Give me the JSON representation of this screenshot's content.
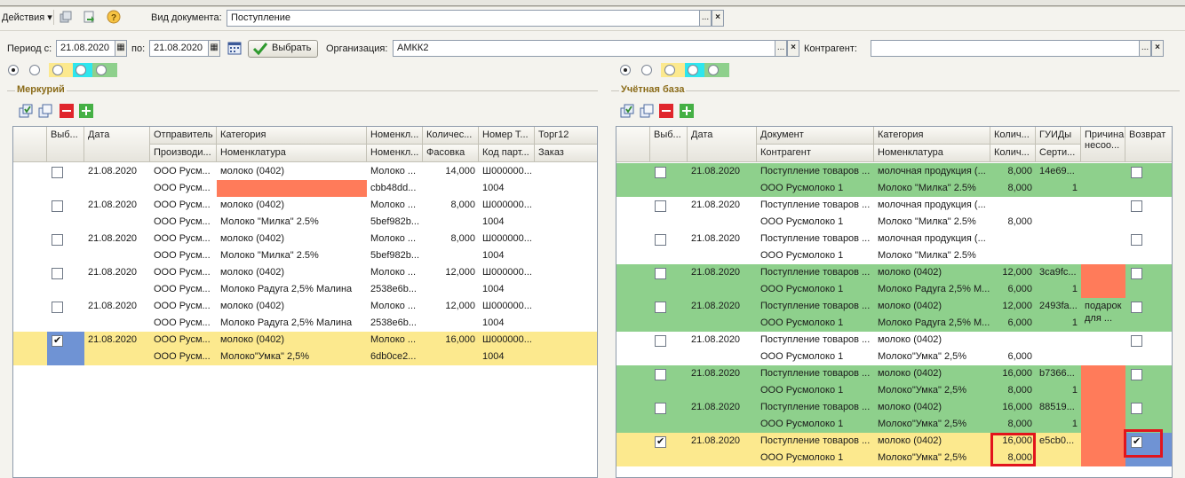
{
  "toolbar": {
    "actions_label": "Действия",
    "doc_type_label": "Вид документа:",
    "doc_type_value": "Поступление"
  },
  "filters": {
    "period_from_label": "Период с:",
    "period_from_value": "21.08.2020",
    "period_to_label": "по:",
    "period_to_value": "21.08.2020",
    "select_button": "Выбрать",
    "org_label": "Организация:",
    "org_value": "АМКК2",
    "counterparty_label": "Контрагент:",
    "counterparty_value": ""
  },
  "colors": {
    "green": "#8ed08c",
    "yellow": "#fce98e",
    "salmon": "#ff7b5a",
    "cyan": "#2ee6ee",
    "select_blue": "#6f93d4"
  },
  "left": {
    "title": "Меркурий",
    "headers_top": [
      "Выб...",
      "Дата",
      "Отправитель",
      "Категория",
      "Номенкл...",
      "Количес...",
      "Номер Т...",
      "Торг12"
    ],
    "headers_bottom": [
      "",
      "",
      "Производи...",
      "Номенклатура",
      "Номенкл...",
      "Фасовка",
      "Код парт...",
      "Заказ"
    ],
    "rows": [
      {
        "checked": false,
        "date": "21.08.2020",
        "sender": "ООО Русм...",
        "category": "молоко (0402)",
        "nom1": "Молоко ...",
        "qty": "14,000",
        "num": "Ш000000...",
        "torg": "",
        "producer": "ООО Русм...",
        "nomenclature": "",
        "nom2": "cbb48dd...",
        "pack": "",
        "code": "1004",
        "order": "",
        "highlight": "none",
        "salmon_nom": true
      },
      {
        "checked": false,
        "date": "21.08.2020",
        "sender": "ООО Русм...",
        "category": "молоко (0402)",
        "nom1": "Молоко ...",
        "qty": "8,000",
        "num": "Ш000000...",
        "torg": "",
        "producer": "ООО Русм...",
        "nomenclature": "Молоко \"Милка\" 2.5%",
        "nom2": "5bef982b...",
        "pack": "",
        "code": "1004",
        "order": "",
        "highlight": "none",
        "salmon_nom": false
      },
      {
        "checked": false,
        "date": "21.08.2020",
        "sender": "ООО Русм...",
        "category": "молоко (0402)",
        "nom1": "Молоко ...",
        "qty": "8,000",
        "num": "Ш000000...",
        "torg": "",
        "producer": "ООО Русм...",
        "nomenclature": "Молоко \"Милка\" 2.5%",
        "nom2": "5bef982b...",
        "pack": "",
        "code": "1004",
        "order": "",
        "highlight": "none",
        "salmon_nom": false
      },
      {
        "checked": false,
        "date": "21.08.2020",
        "sender": "ООО Русм...",
        "category": "молоко (0402)",
        "nom1": "Молоко ...",
        "qty": "12,000",
        "num": "Ш000000...",
        "torg": "",
        "producer": "ООО Русм...",
        "nomenclature": "Молоко Радуга 2,5% Малина",
        "nom2": "2538e6b...",
        "pack": "",
        "code": "1004",
        "order": "",
        "highlight": "none",
        "salmon_nom": false
      },
      {
        "checked": false,
        "date": "21.08.2020",
        "sender": "ООО Русм...",
        "category": "молоко (0402)",
        "nom1": "Молоко ...",
        "qty": "12,000",
        "num": "Ш000000...",
        "torg": "",
        "producer": "ООО Русм...",
        "nomenclature": "Молоко Радуга 2,5% Малина",
        "nom2": "2538e6b...",
        "pack": "",
        "code": "1004",
        "order": "",
        "highlight": "none",
        "salmon_nom": false
      },
      {
        "checked": true,
        "date": "21.08.2020",
        "sender": "ООО Русм...",
        "category": "молоко (0402)",
        "nom1": "Молоко ...",
        "qty": "16,000",
        "num": "Ш000000...",
        "torg": "",
        "producer": "ООО Русм...",
        "nomenclature": "Молоко\"Умка\" 2,5%",
        "nom2": "6db0ce2...",
        "pack": "",
        "code": "1004",
        "order": "",
        "highlight": "yellow",
        "salmon_nom": false
      }
    ]
  },
  "right": {
    "title": "Учётная база",
    "headers_top": [
      "Выб...",
      "Дата",
      "Документ",
      "Категория",
      "Колич...",
      "ГУИДы",
      "Причина несоо...",
      "Возврат"
    ],
    "headers_bottom": [
      "",
      "",
      "Контрагент",
      "Номенклатура",
      "Колич...",
      "Серти...",
      "",
      ""
    ],
    "rows": [
      {
        "checked": false,
        "date": "21.08.2020",
        "doc": "Поступление товаров ...",
        "category": "молочная продукция (...",
        "qty1": "8,000",
        "guid": "14e69...",
        "counterparty": "ООО Русмолоко 1",
        "nomenclature": "Молоко \"Милка\" 2.5%",
        "qty2": "8,000",
        "cert": "1",
        "reason": "",
        "return": false,
        "highlight": "green",
        "reason_salmon": false
      },
      {
        "checked": false,
        "date": "21.08.2020",
        "doc": "Поступление товаров ...",
        "category": "молочная продукция (...",
        "qty1": "",
        "guid": "",
        "counterparty": "ООО Русмолоко 1",
        "nomenclature": "Молоко \"Милка\" 2.5%",
        "qty2": "8,000",
        "cert": "",
        "reason": "",
        "return": false,
        "highlight": "none",
        "reason_salmon": false
      },
      {
        "checked": false,
        "date": "21.08.2020",
        "doc": "Поступление товаров ...",
        "category": "молочная продукция (...",
        "qty1": "",
        "guid": "",
        "counterparty": "ООО Русмолоко 1",
        "nomenclature": "Молоко \"Милка\" 2.5%",
        "qty2": "",
        "cert": "",
        "reason": "",
        "return": false,
        "highlight": "none",
        "reason_salmon": false
      },
      {
        "checked": false,
        "date": "21.08.2020",
        "doc": "Поступление товаров ...",
        "category": "молоко (0402)",
        "qty1": "12,000",
        "guid": "3ca9fc...",
        "counterparty": "ООО Русмолоко 1",
        "nomenclature": "Молоко Радуга 2,5% М...",
        "qty2": "6,000",
        "cert": "1",
        "reason": "",
        "return": false,
        "highlight": "green",
        "reason_salmon": true
      },
      {
        "checked": false,
        "date": "21.08.2020",
        "doc": "Поступление товаров ...",
        "category": "молоко (0402)",
        "qty1": "12,000",
        "guid": "2493fa...",
        "counterparty": "ООО Русмолоко 1",
        "nomenclature": "Молоко Радуга 2,5% М...",
        "qty2": "6,000",
        "cert": "1",
        "reason": "подарок для ...",
        "return": false,
        "highlight": "green",
        "reason_salmon": false
      },
      {
        "checked": false,
        "date": "21.08.2020",
        "doc": "Поступление товаров ...",
        "category": "молоко (0402)",
        "qty1": "",
        "guid": "",
        "counterparty": "ООО Русмолоко 1",
        "nomenclature": "Молоко\"Умка\" 2,5%",
        "qty2": "6,000",
        "cert": "",
        "reason": "",
        "return": false,
        "highlight": "none",
        "reason_salmon": false
      },
      {
        "checked": false,
        "date": "21.08.2020",
        "doc": "Поступление товаров ...",
        "category": "молоко (0402)",
        "qty1": "16,000",
        "guid": "b7366...",
        "counterparty": "ООО Русмолоко 1",
        "nomenclature": "Молоко\"Умка\" 2,5%",
        "qty2": "8,000",
        "cert": "1",
        "reason": "",
        "return": false,
        "highlight": "green",
        "reason_salmon": true
      },
      {
        "checked": false,
        "date": "21.08.2020",
        "doc": "Поступление товаров ...",
        "category": "молоко (0402)",
        "qty1": "16,000",
        "guid": "88519...",
        "counterparty": "ООО Русмолоко 1",
        "nomenclature": "Молоко\"Умка\" 2,5%",
        "qty2": "8,000",
        "cert": "1",
        "reason": "",
        "return": false,
        "highlight": "green",
        "reason_salmon": true
      },
      {
        "checked": true,
        "date": "21.08.2020",
        "doc": "Поступление товаров ...",
        "category": "молоко (0402)",
        "qty1": "16,000",
        "guid": "e5cb0...",
        "counterparty": "ООО Русмолоко 1",
        "nomenclature": "Молоко\"Умка\" 2,5%",
        "qty2": "8,000",
        "cert": "",
        "reason": "",
        "return": true,
        "highlight": "yellow",
        "reason_salmon": true
      }
    ]
  }
}
